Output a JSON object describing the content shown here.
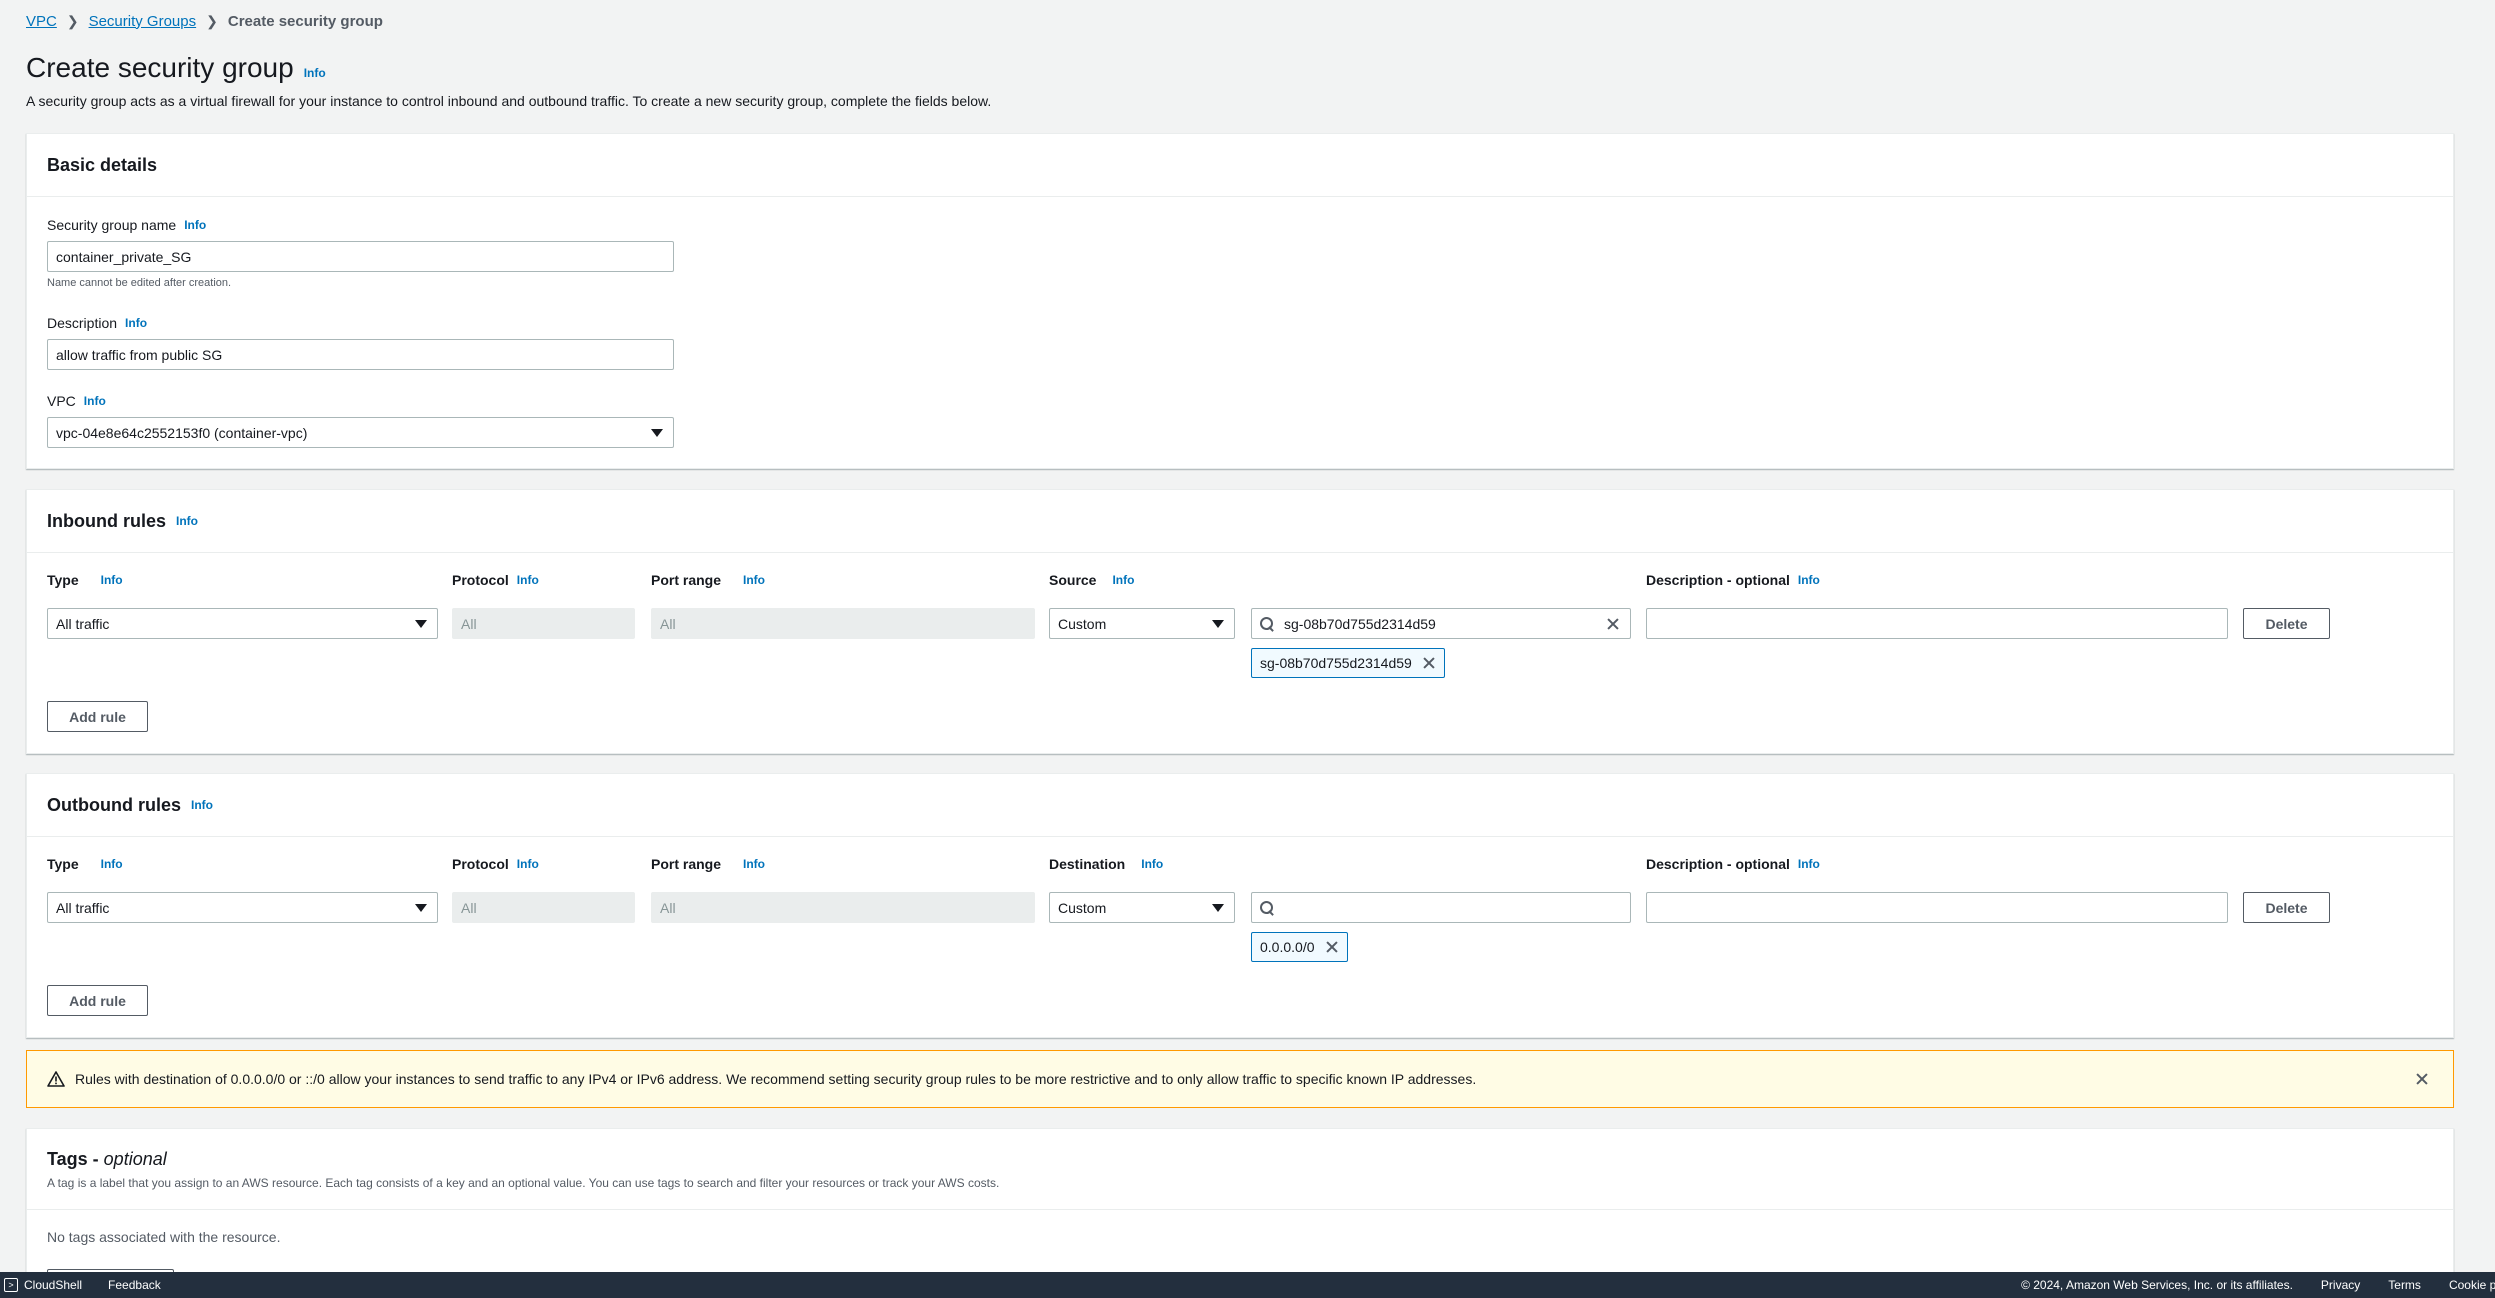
{
  "breadcrumb": {
    "vpc": "VPC",
    "security_groups": "Security Groups",
    "current": "Create security group"
  },
  "header": {
    "title": "Create security group",
    "info": "Info",
    "subtitle": "A security group acts as a virtual firewall for your instance to control inbound and outbound traffic. To create a new security group, complete the fields below."
  },
  "basic": {
    "title": "Basic details",
    "name_label": "Security group name",
    "name_value": "container_private_SG",
    "name_hint": "Name cannot be edited after creation.",
    "desc_label": "Description",
    "desc_value": "allow traffic from public SG",
    "vpc_label": "VPC",
    "vpc_value": "vpc-04e8e64c2552153f0 (container-vpc)"
  },
  "inbound": {
    "title": "Inbound rules",
    "type_label": "Type",
    "protocol_label": "Protocol",
    "port_label": "Port range",
    "source_label": "Source",
    "desc_label": "Description - optional",
    "type_value": "All traffic",
    "protocol_value": "All",
    "port_value": "All",
    "source_value": "Custom",
    "search_value": "sg-08b70d755d2314d59",
    "token": "sg-08b70d755d2314d59",
    "delete": "Delete",
    "add_rule": "Add rule"
  },
  "outbound": {
    "title": "Outbound rules",
    "type_label": "Type",
    "protocol_label": "Protocol",
    "port_label": "Port range",
    "dest_label": "Destination",
    "desc_label": "Description - optional",
    "type_value": "All traffic",
    "protocol_value": "All",
    "port_value": "All",
    "dest_value": "Custom",
    "token": "0.0.0.0/0",
    "delete": "Delete",
    "add_rule": "Add rule"
  },
  "warning": {
    "text": "Rules with destination of 0.0.0.0/0 or ::/0 allow your instances to send traffic to any IPv4 or IPv6 address. We recommend setting security group rules to be more restrictive and to only allow traffic to specific known IP addresses."
  },
  "tags": {
    "title": "Tags - ",
    "title_optional": "optional",
    "subtitle": "A tag is a label that you assign to an AWS resource. Each tag consists of a key and an optional value. You can use tags to search and filter your resources or track your AWS costs.",
    "empty": "No tags associated with the resource."
  },
  "footer": {
    "cloudshell": "CloudShell",
    "feedback": "Feedback",
    "copyright": "© 2024, Amazon Web Services, Inc. or its affiliates.",
    "privacy": "Privacy",
    "terms": "Terms",
    "cookie": "Cookie preferences"
  },
  "colors": {
    "link": "#0073bb",
    "warning_bg": "#fffce5",
    "warning_border": "#ff9900",
    "footer_bg": "#232f3e"
  }
}
